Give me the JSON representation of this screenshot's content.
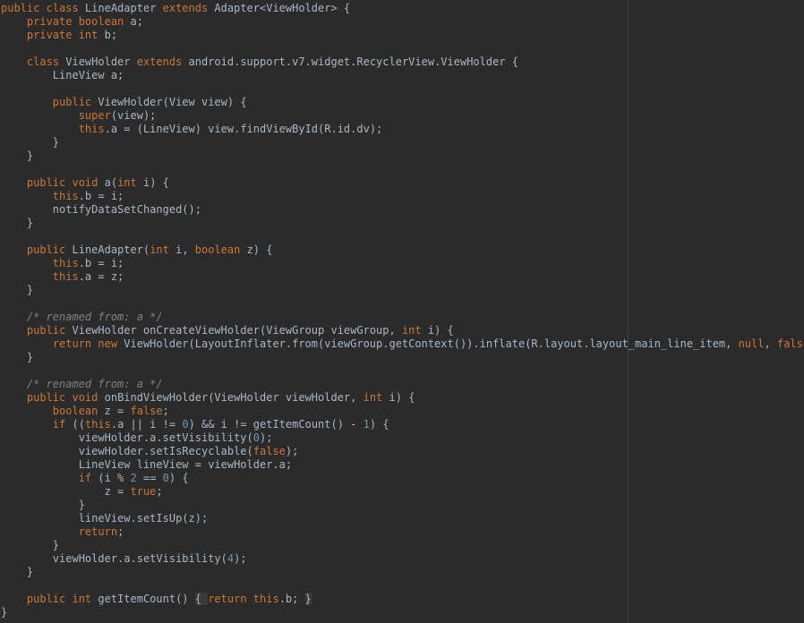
{
  "editor": {
    "theme": "darcula",
    "colors": {
      "background": "#2b2b2b",
      "text": "#a9b7c6",
      "keyword": "#cc7832",
      "number": "#6897bb",
      "comment": "#808080",
      "right_margin": "#3c3f41"
    },
    "lines": [
      [
        {
          "t": "public class",
          "c": "kw"
        },
        {
          "t": " LineAdapter "
        },
        {
          "t": "extends",
          "c": "kw"
        },
        {
          "t": " Adapter<ViewHolder> {"
        }
      ],
      [
        {
          "t": "    "
        },
        {
          "t": "private boolean",
          "c": "kw"
        },
        {
          "t": " a;"
        }
      ],
      [
        {
          "t": "    "
        },
        {
          "t": "private int",
          "c": "kw"
        },
        {
          "t": " b;"
        }
      ],
      [],
      [
        {
          "t": "    "
        },
        {
          "t": "class",
          "c": "kw"
        },
        {
          "t": " ViewHolder "
        },
        {
          "t": "extends",
          "c": "kw"
        },
        {
          "t": " android.support.v7.widget.RecyclerView.ViewHolder {"
        }
      ],
      [
        {
          "t": "        LineView a;"
        }
      ],
      [],
      [
        {
          "t": "        "
        },
        {
          "t": "public",
          "c": "kw"
        },
        {
          "t": " ViewHolder(View view) {"
        }
      ],
      [
        {
          "t": "            "
        },
        {
          "t": "super",
          "c": "kw"
        },
        {
          "t": "(view);"
        }
      ],
      [
        {
          "t": "            "
        },
        {
          "t": "this",
          "c": "kw"
        },
        {
          "t": ".a = (LineView) view.findViewById(R.id.dv);"
        }
      ],
      [
        {
          "t": "        }"
        }
      ],
      [
        {
          "t": "    }"
        }
      ],
      [],
      [
        {
          "t": "    "
        },
        {
          "t": "public void",
          "c": "kw"
        },
        {
          "t": " a("
        },
        {
          "t": "int",
          "c": "kw"
        },
        {
          "t": " i) {"
        }
      ],
      [
        {
          "t": "        "
        },
        {
          "t": "this",
          "c": "kw"
        },
        {
          "t": ".b = i;"
        }
      ],
      [
        {
          "t": "        notifyDataSetChanged();"
        }
      ],
      [
        {
          "t": "    }"
        }
      ],
      [],
      [
        {
          "t": "    "
        },
        {
          "t": "public",
          "c": "kw"
        },
        {
          "t": " LineAdapter("
        },
        {
          "t": "int",
          "c": "kw"
        },
        {
          "t": " i, "
        },
        {
          "t": "boolean",
          "c": "kw"
        },
        {
          "t": " z) {"
        }
      ],
      [
        {
          "t": "        "
        },
        {
          "t": "this",
          "c": "kw"
        },
        {
          "t": ".b = i;"
        }
      ],
      [
        {
          "t": "        "
        },
        {
          "t": "this",
          "c": "kw"
        },
        {
          "t": ".a = z;"
        }
      ],
      [
        {
          "t": "    }"
        }
      ],
      [],
      [
        {
          "t": "    "
        },
        {
          "t": "/* renamed from: a */",
          "c": "cm"
        }
      ],
      [
        {
          "t": "    "
        },
        {
          "t": "public",
          "c": "kw"
        },
        {
          "t": " ViewHolder onCreateViewHolder(ViewGroup viewGroup, "
        },
        {
          "t": "int",
          "c": "kw"
        },
        {
          "t": " i) {"
        }
      ],
      [
        {
          "t": "        "
        },
        {
          "t": "return new",
          "c": "kw"
        },
        {
          "t": " ViewHolder(LayoutInflater.from(viewGroup.getContext()).inflate(R.layout.layout_main_line_item, "
        },
        {
          "t": "null",
          "c": "kw"
        },
        {
          "t": ", "
        },
        {
          "t": "false",
          "c": "kw"
        },
        {
          "t": "));"
        }
      ],
      [
        {
          "t": "    }"
        }
      ],
      [],
      [
        {
          "t": "    "
        },
        {
          "t": "/* renamed from: a */",
          "c": "cm"
        }
      ],
      [
        {
          "t": "    "
        },
        {
          "t": "public void",
          "c": "kw"
        },
        {
          "t": " onBindViewHolder(ViewHolder viewHolder, "
        },
        {
          "t": "int",
          "c": "kw"
        },
        {
          "t": " i) {"
        }
      ],
      [
        {
          "t": "        "
        },
        {
          "t": "boolean",
          "c": "kw"
        },
        {
          "t": " z = "
        },
        {
          "t": "false",
          "c": "kw"
        },
        {
          "t": ";"
        }
      ],
      [
        {
          "t": "        "
        },
        {
          "t": "if",
          "c": "kw"
        },
        {
          "t": " (("
        },
        {
          "t": "this",
          "c": "kw"
        },
        {
          "t": ".a || i != "
        },
        {
          "t": "0",
          "c": "num"
        },
        {
          "t": ") && i != getItemCount() - "
        },
        {
          "t": "1",
          "c": "num"
        },
        {
          "t": ") {"
        }
      ],
      [
        {
          "t": "            viewHolder.a.setVisibility("
        },
        {
          "t": "0",
          "c": "num"
        },
        {
          "t": ");"
        }
      ],
      [
        {
          "t": "            viewHolder.setIsRecyclable("
        },
        {
          "t": "false",
          "c": "kw"
        },
        {
          "t": ");"
        }
      ],
      [
        {
          "t": "            LineView lineView = viewHolder.a;"
        }
      ],
      [
        {
          "t": "            "
        },
        {
          "t": "if",
          "c": "kw"
        },
        {
          "t": " (i % "
        },
        {
          "t": "2",
          "c": "num"
        },
        {
          "t": " == "
        },
        {
          "t": "0",
          "c": "num"
        },
        {
          "t": ") {"
        }
      ],
      [
        {
          "t": "                z = "
        },
        {
          "t": "true",
          "c": "kw"
        },
        {
          "t": ";"
        }
      ],
      [
        {
          "t": "            }"
        }
      ],
      [
        {
          "t": "            lineView.setIsUp(z);"
        }
      ],
      [
        {
          "t": "            "
        },
        {
          "t": "return",
          "c": "kw"
        },
        {
          "t": ";"
        }
      ],
      [
        {
          "t": "        }"
        }
      ],
      [
        {
          "t": "        viewHolder.a.setVisibility("
        },
        {
          "t": "4",
          "c": "num"
        },
        {
          "t": ");"
        }
      ],
      [
        {
          "t": "    }"
        }
      ],
      [],
      [
        {
          "t": "    "
        },
        {
          "t": "public int",
          "c": "kw"
        },
        {
          "t": " getItemCount() "
        },
        {
          "t": "{ ",
          "c": "fold"
        },
        {
          "t": "return this",
          "c": "kw"
        },
        {
          "t": ".b; "
        },
        {
          "t": "}",
          "c": "fold"
        }
      ],
      [
        {
          "t": "}"
        }
      ]
    ]
  }
}
